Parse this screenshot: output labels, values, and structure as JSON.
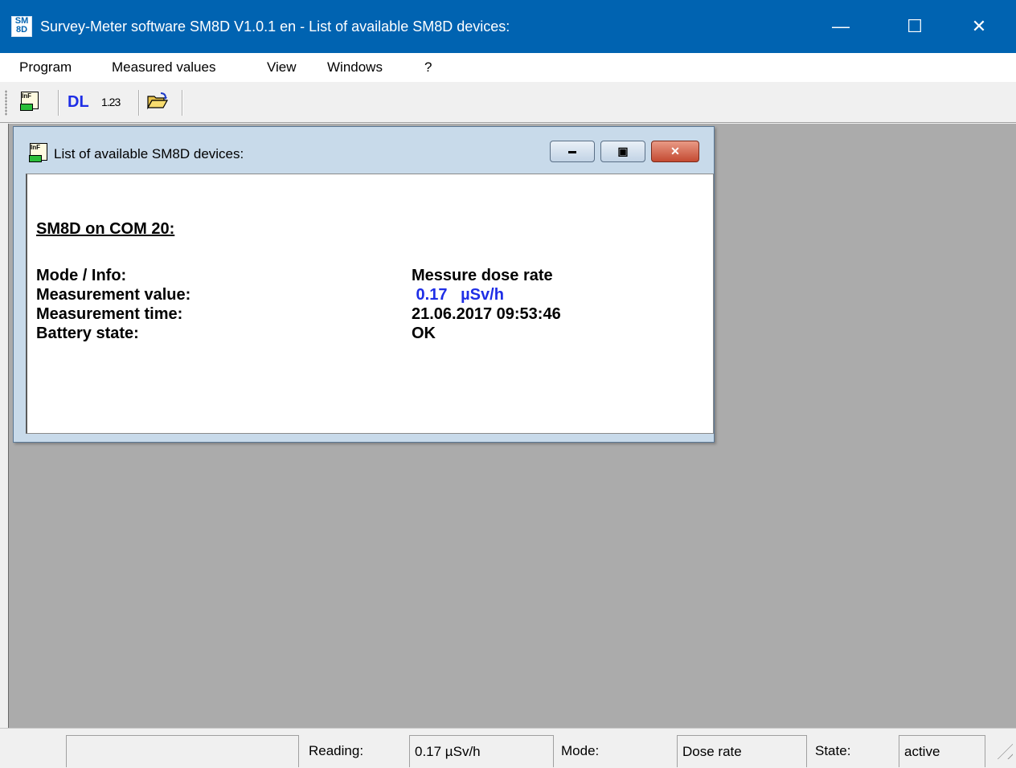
{
  "window": {
    "app_icon_top": "SM",
    "app_icon_bottom": "8D",
    "title": "Survey-Meter software SM8D  V1.0.1 en - List of available SM8D devices:",
    "minimize_glyph": "—",
    "maximize_glyph": "☐",
    "close_glyph": "✕"
  },
  "menu": {
    "items": [
      "Program",
      "Measured values",
      "View",
      "Windows",
      "?"
    ]
  },
  "toolbar": {
    "info_icon_text": "InF",
    "dl_label": "DL",
    "num_label": "1.23"
  },
  "child_window": {
    "title": "List of available SM8D devices:",
    "minimize_glyph": "▬",
    "restore_glyph": "▣",
    "close_glyph": "✕",
    "device_header": "SM8D on COM 20:",
    "rows": [
      {
        "label": "Mode / Info:",
        "value": "Messure dose rate"
      },
      {
        "label": "Measurement value:",
        "value": " 0.17   µSv/h"
      },
      {
        "label": "Measurement time:",
        "value": "21.06.2017 09:53:46"
      },
      {
        "label": "Battery state:",
        "value": "OK"
      }
    ]
  },
  "statusbar": {
    "field1": "",
    "reading_label": "Reading:",
    "reading_value": "0.17  µSv/h",
    "mode_label": "Mode:",
    "mode_value": "Dose rate",
    "state_label": "State:",
    "state_value": "active"
  },
  "colors": {
    "titlebar": "#0063b1",
    "mdi_background": "#ababab",
    "measurement_value": "#1e2ee6"
  }
}
